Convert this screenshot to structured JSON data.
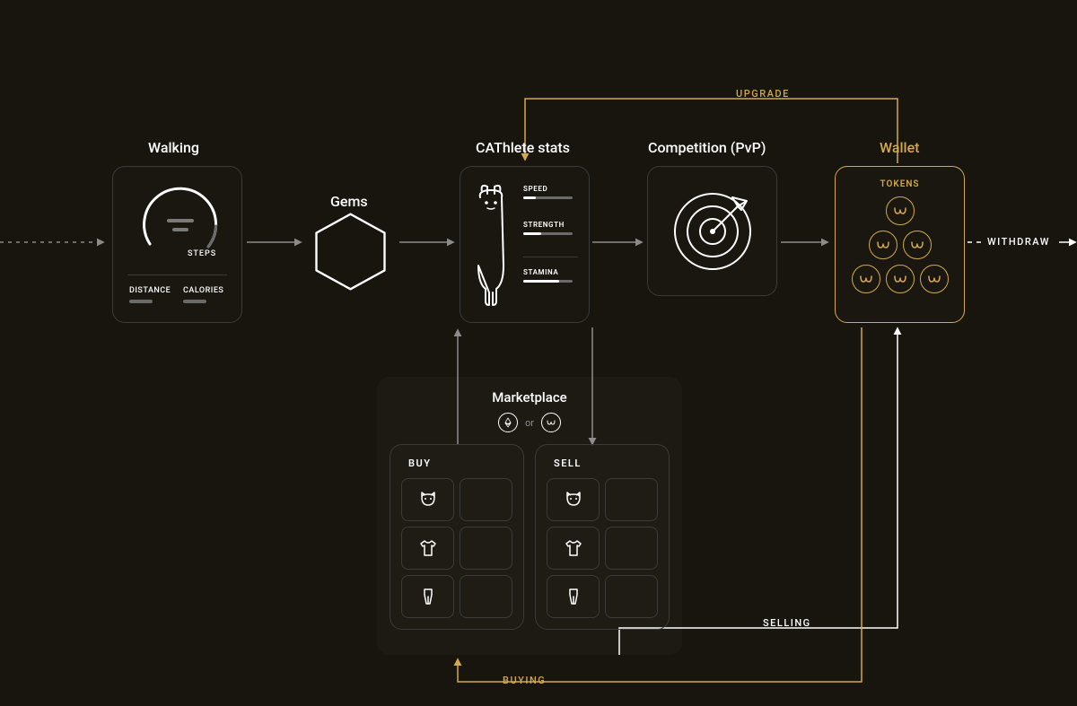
{
  "labels": {
    "walking": "Walking",
    "gems": "Gems",
    "cathlete": "CAThlete stats",
    "competition": "Competition (PvP)",
    "wallet": "Wallet",
    "marketplace": "Marketplace",
    "withdraw": "WITHDRAW"
  },
  "walking": {
    "steps": "STEPS",
    "distance": "DISTANCE",
    "calories": "CALORIES"
  },
  "cathlete": {
    "stat1": "SPEED",
    "stat2": "STRENGTH",
    "stat3": "STAMINA"
  },
  "wallet": {
    "tokens": "TOKENS"
  },
  "market": {
    "buy": "BUY",
    "sell": "SELL",
    "or": "or"
  },
  "flows": {
    "upgrade": "UPGRADE",
    "selling": "SELLING",
    "buying": "BUYING"
  },
  "colors": {
    "gold": "#d4a94a",
    "background": "#18150f"
  }
}
